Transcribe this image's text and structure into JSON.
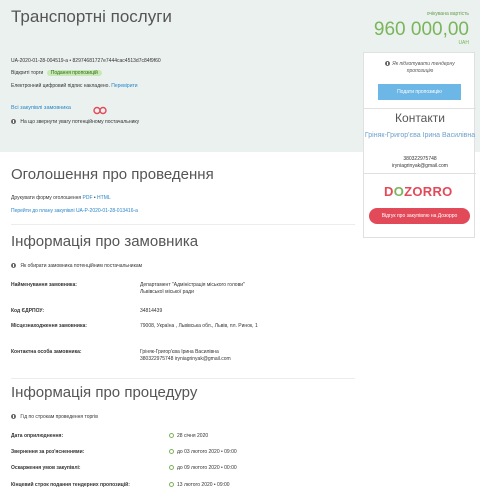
{
  "header": {
    "title": "Транспортні послуги",
    "estimate_label": "очікувана вартість",
    "amount": "960 000,00",
    "currency": "UAH",
    "tender_id": "UA-2020-01-28-004519-a • 82974681727e7444cac4513d7c84f9f60",
    "trading_label": "Відкриті торги",
    "status_badge": "Подання пропозицій",
    "signature_text": "Електронний цифровий підпис накладено.",
    "verify_link": "Перевірити",
    "all_purchases_link": "Всі закупівлі замовника",
    "attention_note": "На що звернути увагу потенційному постачальнику"
  },
  "sidebar": {
    "note": "Як підготувати тендерну пропозицію",
    "submit_button": "Подати пропозицію",
    "contacts_heading": "Контакти",
    "contact_name": "Гріняк-Григор'єва Ірина Василівна",
    "phone": "380322975748",
    "email": "iryniagrinyak@gmail.com",
    "logo_pre": "D",
    "logo_o": "O",
    "logo_post": "ZORRO",
    "dozorro_button": "Відгук про закупівлю на Дозорро"
  },
  "announcement": {
    "heading": "Оголошення про проведення",
    "print_label": "Друкувати форму оголошення",
    "pdf": "PDF",
    "html": "HTML",
    "plan_link": "Перейти до плану закупівлі UA-P-2020-01-28-013416-a"
  },
  "customer": {
    "heading": "Інформація про замовника",
    "note": "Як обирати замовника потенційним постачальникам",
    "rows": [
      {
        "label": "Найменування замовника:",
        "value": "Департамент \"Адміністрація міського голови\" Львівської міської ради"
      },
      {
        "label": "Код ЄДРПОУ:",
        "value": "34814439"
      },
      {
        "label": "Місцезнаходження замовника:",
        "value": "79008, Україна , Львівська обл., Львів, пл. Ринок, 1"
      },
      {
        "label": "Контактна особа замовника:",
        "value": "Гріняк-Григор'єва Ірина Василівна 380322975748 iryniagrinyak@gmail.com"
      }
    ]
  },
  "procedure": {
    "heading": "Інформація про процедуру",
    "note": "Гід по строкам проведення торгів",
    "rows": [
      {
        "label": "Дата оприлюднення:",
        "value": "28 січня 2020"
      },
      {
        "label": "Звернення за роз'ясненнями:",
        "value": "до  03 лютого 2020  •  09:00"
      },
      {
        "label": "Оскарження умов закупівлі:",
        "value": "до  09 лютого 2020  •  00:00"
      },
      {
        "label": "Кінцевий строк подання тендерних пропозицій:",
        "value": "13 лютого 2020  •  09:00"
      }
    ]
  },
  "colors": {
    "accent_green": "#7ab55c",
    "link_blue": "#2a86c8",
    "dozorro_red": "#e34a59",
    "header_bg": "#eaf1ee"
  }
}
